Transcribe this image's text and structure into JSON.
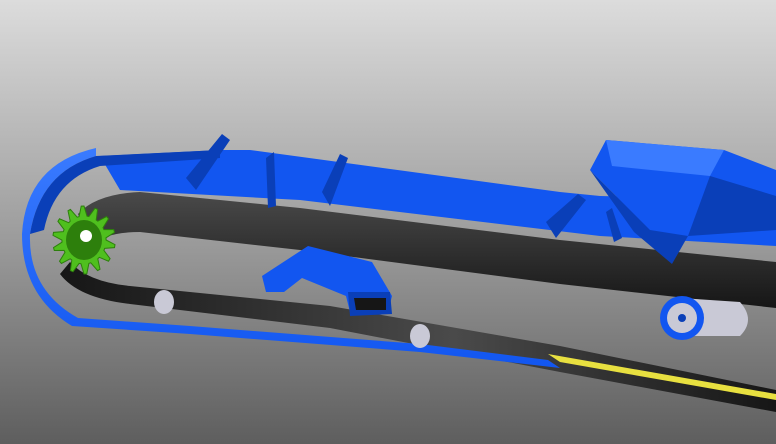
{
  "scene": {
    "subject": "conveyor-3d-model",
    "icons": [
      "drive-sprocket-icon",
      "idler-roller-icon",
      "tail-pulley-icon",
      "hopper-icon"
    ]
  },
  "colors": {
    "background_top": "#dcdcdc",
    "background_mid": "#9a9a9a",
    "background_bottom": "#5e5e5e",
    "frame_blue": "#1256f0",
    "frame_blue_light": "#3a7bff",
    "frame_blue_dark": "#0a3fb8",
    "belt_dark": "#161616",
    "belt_mid": "#2b2b2b",
    "belt_sheen": "#4a4a4a",
    "sprocket_green": "#4fbf1e",
    "sprocket_green_dark": "#2d7f0c",
    "idler_grey": "#c9c9d6",
    "skirt_yellow": "#e8e040"
  }
}
